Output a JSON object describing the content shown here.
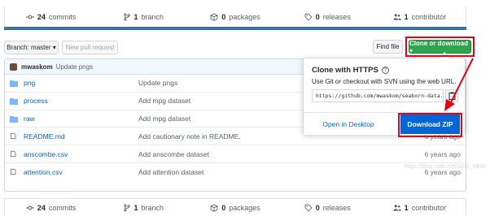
{
  "stats": {
    "commits_count": "24",
    "commits_label": "commits",
    "branch_count": "1",
    "branch_label": "branch",
    "packages_count": "0",
    "packages_label": "packages",
    "releases_count": "0",
    "releases_label": "releases",
    "contributor_count": "1",
    "contributor_label": "contributor"
  },
  "toolbar": {
    "branch_label": "Branch: master ▾",
    "new_pull_request": "New pull request",
    "find_file": "Find file",
    "clone_download": "Clone or download ▾"
  },
  "latest_commit": {
    "author": "mwaskom",
    "message": "Update pngs"
  },
  "files": [
    {
      "type": "folder",
      "name": "png",
      "message": "Update pngs",
      "age": ""
    },
    {
      "type": "folder",
      "name": "process",
      "message": "Add mpg dataset",
      "age": ""
    },
    {
      "type": "folder",
      "name": "raw",
      "message": "Add mpg dataset",
      "age": ""
    },
    {
      "type": "file",
      "name": "README.md",
      "message": "Add cautionary note in README.",
      "age": "6 years ago"
    },
    {
      "type": "file",
      "name": "anscombe.csv",
      "message": "Add anscombe dataset",
      "age": "6 years ago"
    },
    {
      "type": "file",
      "name": "attention.csv",
      "message": "Add attention dataset",
      "age": "6 years ago"
    }
  ],
  "clone_popover": {
    "title": "Clone with HTTPS",
    "help": "?",
    "description": "Use Git or checkout with SVN using the web URL.",
    "url": "https://github.com/mwaskom/seaborn-data.",
    "open_desktop": "Open in Desktop",
    "download_zip": "Download ZIP"
  },
  "watermark": "https://blog.csdn.net/u011_0948",
  "colors": {
    "accent_green": "#2ea44f",
    "link_blue": "#0366d6",
    "annotation_red": "#e60012"
  }
}
